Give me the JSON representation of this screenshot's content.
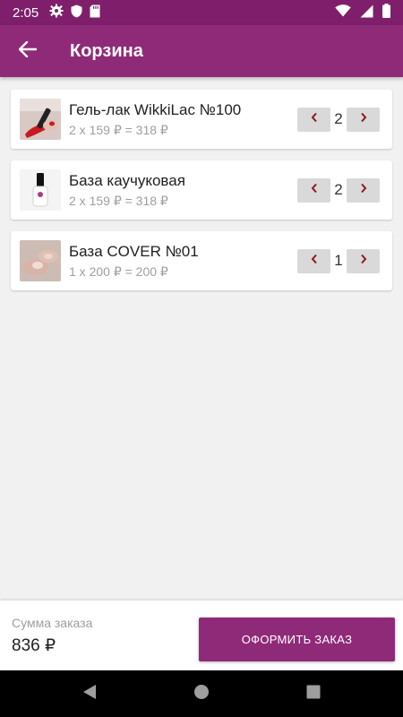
{
  "status_bar": {
    "time": "2:05",
    "icons": [
      "gear-icon",
      "shield-icon",
      "sd-card-icon",
      "wifi-icon",
      "signal-icon",
      "battery-icon"
    ]
  },
  "app_bar": {
    "title": "Корзина",
    "back_icon": "arrow-back-icon"
  },
  "cart": {
    "items": [
      {
        "name": "Гель-лак WikkiLac №100",
        "price_line": "2 x 159 ₽ = 318 ₽",
        "quantity": "2",
        "image": "red-nail-polish-photo"
      },
      {
        "name": "База каучуковая",
        "price_line": "2 x 159 ₽ = 318 ₽",
        "quantity": "2",
        "image": "base-bottle-photo"
      },
      {
        "name": "База COVER №01",
        "price_line": "1 x 200 ₽ = 200 ₽",
        "quantity": "1",
        "image": "nude-nails-photo"
      }
    ]
  },
  "summary": {
    "label": "Сумма заказа",
    "total": "836 ₽",
    "order_button": "ОФОРМИТЬ ЗАКАЗ"
  },
  "colors": {
    "status_bar": "#7f1f6b",
    "app_bar": "#8f2a78",
    "accent_arrow": "#8b1a1a",
    "background": "#f1f1f1"
  }
}
